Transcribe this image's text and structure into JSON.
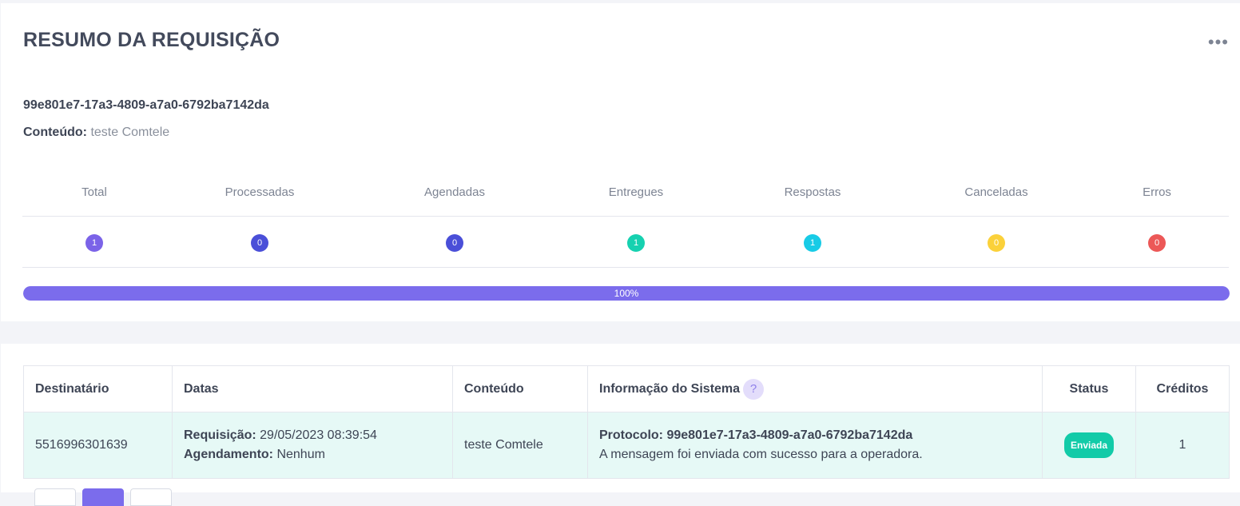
{
  "summary": {
    "title": "RESUMO DA REQUISIÇÃO",
    "more_icon": "•••",
    "request_id": "99e801e7-17a3-4809-a7a0-6792ba7142da",
    "content_label": "Conteúdo:",
    "content_value": "teste Comtele",
    "stats": [
      {
        "label": "Total",
        "value": "1",
        "color": "#7b63e8"
      },
      {
        "label": "Processadas",
        "value": "0",
        "color": "#4a4fd8"
      },
      {
        "label": "Agendadas",
        "value": "0",
        "color": "#4a4fd8"
      },
      {
        "label": "Entregues",
        "value": "1",
        "color": "#16d1b0"
      },
      {
        "label": "Respostas",
        "value": "1",
        "color": "#18cbe6"
      },
      {
        "label": "Canceladas",
        "value": "0",
        "color": "#fbd13a"
      },
      {
        "label": "Erros",
        "value": "0",
        "color": "#ec5857"
      }
    ],
    "progress": {
      "percent": 100,
      "label": "100%"
    }
  },
  "table": {
    "headers": {
      "recipient": "Destinatário",
      "dates": "Datas",
      "content": "Conteúdo",
      "system_info": "Informação do Sistema",
      "help_icon": "?",
      "status": "Status",
      "credits": "Créditos"
    },
    "rows": [
      {
        "recipient": "5516996301639",
        "request_label": "Requisição:",
        "request_date": "29/05/2023 08:39:54",
        "schedule_label": "Agendamento:",
        "schedule_value": "Nenhum",
        "content": "teste Comtele",
        "protocol_label": "Protocolo:",
        "protocol_value": "99e801e7-17a3-4809-a7a0-6792ba7142da",
        "system_message": "A mensagem foi enviada com sucesso para a operadora.",
        "status": "Enviada",
        "credits": "1"
      }
    ]
  }
}
